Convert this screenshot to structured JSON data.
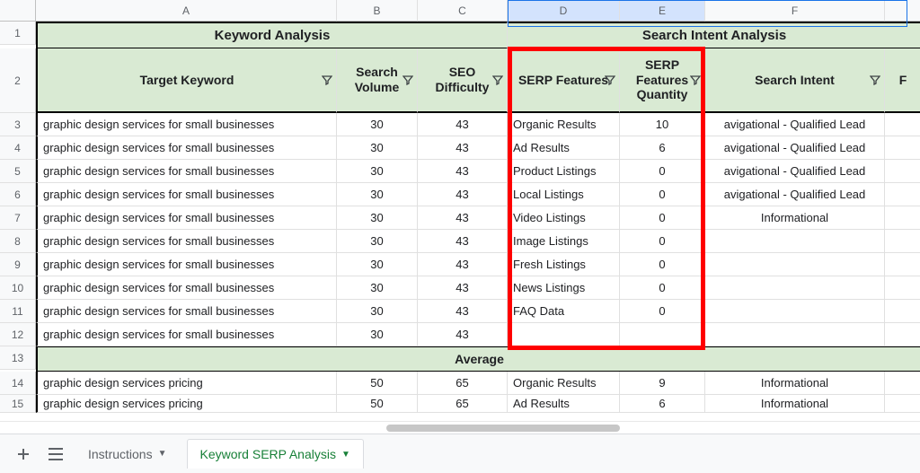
{
  "columns": [
    "A",
    "B",
    "C",
    "D",
    "E",
    "F",
    ""
  ],
  "rows": [
    "1",
    "2",
    "3",
    "4",
    "5",
    "6",
    "7",
    "8",
    "9",
    "10",
    "11",
    "12",
    "13",
    "14",
    "15"
  ],
  "section1": {
    "keyword": "Keyword Analysis",
    "intent": "Search Intent Analysis"
  },
  "headers": {
    "target": "Target Keyword",
    "volume": "Search Volume",
    "seo": "SEO Difficulty",
    "serpf": "SERP Features",
    "serpq": "SERP Features Quantity",
    "intent": "Search Intent"
  },
  "avg_label": "Average",
  "keyword1": "graphic design services for small businesses",
  "keyword2": "graphic design services pricing",
  "data1": [
    {
      "vol": "30",
      "seo": "43",
      "serpf": "Organic Results",
      "serpq": "10",
      "intent": "avigational - Qualified Lead"
    },
    {
      "vol": "30",
      "seo": "43",
      "serpf": "Ad Results",
      "serpq": "6",
      "intent": "avigational - Qualified Lead"
    },
    {
      "vol": "30",
      "seo": "43",
      "serpf": "Product Listings",
      "serpq": "0",
      "intent": "avigational - Qualified Lead"
    },
    {
      "vol": "30",
      "seo": "43",
      "serpf": "Local Listings",
      "serpq": "0",
      "intent": "avigational - Qualified Lead"
    },
    {
      "vol": "30",
      "seo": "43",
      "serpf": "Video Listings",
      "serpq": "0",
      "intent": "Informational"
    },
    {
      "vol": "30",
      "seo": "43",
      "serpf": "Image Listings",
      "serpq": "0",
      "intent": ""
    },
    {
      "vol": "30",
      "seo": "43",
      "serpf": "Fresh Listings",
      "serpq": "0",
      "intent": ""
    },
    {
      "vol": "30",
      "seo": "43",
      "serpf": "News Listings",
      "serpq": "0",
      "intent": ""
    },
    {
      "vol": "30",
      "seo": "43",
      "serpf": "FAQ Data",
      "serpq": "0",
      "intent": ""
    },
    {
      "vol": "30",
      "seo": "43",
      "serpf": "",
      "serpq": "",
      "intent": ""
    }
  ],
  "data2": [
    {
      "vol": "50",
      "seo": "65",
      "serpf": "Organic Results",
      "serpq": "9",
      "intent": "Informational"
    },
    {
      "vol": "50",
      "seo": "65",
      "serpf": "Ad Results",
      "serpq": "6",
      "intent": "Informational"
    }
  ],
  "tabs": {
    "instructions": "Instructions",
    "kserp": "Keyword SERP Analysis"
  }
}
